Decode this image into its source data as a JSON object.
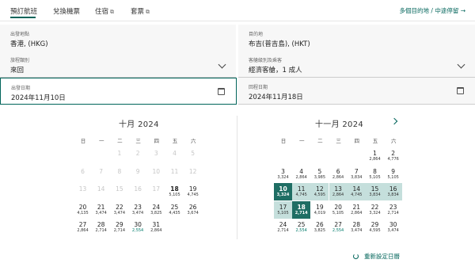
{
  "tabs": [
    {
      "label": "預訂航班",
      "external": false
    },
    {
      "label": "兌換機票",
      "external": false
    },
    {
      "label": "住宿",
      "external": true
    },
    {
      "label": "套票",
      "external": true
    }
  ],
  "multi_city_link": "多個目的地 / 中途停留 →",
  "form": {
    "origin": {
      "label": "出發地點",
      "value": "香港, (HKG)"
    },
    "destination": {
      "label": "目的地",
      "value": "布吉(普吉島), (HKT)"
    },
    "trip_type": {
      "label": "旅程類別",
      "value": "來回"
    },
    "cabin": {
      "label": "客艙級別及乘客",
      "value": "經濟客艙，1 成人"
    },
    "depart": {
      "label": "出發日期",
      "value": "2024年11月10日"
    },
    "return": {
      "label": "回程日期",
      "value": "2024年11月18日"
    }
  },
  "weekdays": [
    "日",
    "一",
    "二",
    "三",
    "四",
    "五",
    "六"
  ],
  "calendars": [
    {
      "title": "十月 2024",
      "days": [
        {
          "d": "",
          "p": ""
        },
        {
          "d": "",
          "p": ""
        },
        {
          "d": "1",
          "p": "",
          "s": "disabled"
        },
        {
          "d": "2",
          "p": "",
          "s": "disabled"
        },
        {
          "d": "3",
          "p": "",
          "s": "disabled"
        },
        {
          "d": "4",
          "p": "",
          "s": "disabled"
        },
        {
          "d": "5",
          "p": "",
          "s": "disabled"
        },
        {
          "d": "6",
          "p": "",
          "s": "disabled"
        },
        {
          "d": "7",
          "p": "",
          "s": "disabled"
        },
        {
          "d": "8",
          "p": "",
          "s": "disabled"
        },
        {
          "d": "9",
          "p": "",
          "s": "disabled"
        },
        {
          "d": "10",
          "p": "",
          "s": "disabled"
        },
        {
          "d": "11",
          "p": "",
          "s": "disabled"
        },
        {
          "d": "12",
          "p": "",
          "s": "disabled"
        },
        {
          "d": "13",
          "p": "",
          "s": "disabled"
        },
        {
          "d": "14",
          "p": "",
          "s": "disabled"
        },
        {
          "d": "15",
          "p": "",
          "s": "disabled"
        },
        {
          "d": "16",
          "p": "",
          "s": "disabled"
        },
        {
          "d": "17",
          "p": "",
          "s": "disabled"
        },
        {
          "d": "18",
          "p": "5,105",
          "s": "bold"
        },
        {
          "d": "19",
          "p": "4,745"
        },
        {
          "d": "20",
          "p": "4,135"
        },
        {
          "d": "21",
          "p": "3,474"
        },
        {
          "d": "22",
          "p": "3,474"
        },
        {
          "d": "23",
          "p": "3,474"
        },
        {
          "d": "24",
          "p": "3,825"
        },
        {
          "d": "25",
          "p": "4,435"
        },
        {
          "d": "26",
          "p": "3,674"
        },
        {
          "d": "27",
          "p": "2,864"
        },
        {
          "d": "28",
          "p": "2,714"
        },
        {
          "d": "29",
          "p": "2,714"
        },
        {
          "d": "30",
          "p": "2,554",
          "s": "green"
        },
        {
          "d": "31",
          "p": "2,864"
        },
        {
          "d": "",
          "p": ""
        },
        {
          "d": "",
          "p": ""
        }
      ]
    },
    {
      "title": "十一月 2024",
      "days": [
        {
          "d": "",
          "p": ""
        },
        {
          "d": "",
          "p": ""
        },
        {
          "d": "",
          "p": ""
        },
        {
          "d": "",
          "p": ""
        },
        {
          "d": "",
          "p": ""
        },
        {
          "d": "1",
          "p": "2,864"
        },
        {
          "d": "2",
          "p": "4,776"
        },
        {
          "d": "3",
          "p": "3,324"
        },
        {
          "d": "4",
          "p": "2,864"
        },
        {
          "d": "5",
          "p": "3,985"
        },
        {
          "d": "6",
          "p": "2,864"
        },
        {
          "d": "7",
          "p": "3,834"
        },
        {
          "d": "8",
          "p": "5,105"
        },
        {
          "d": "9",
          "p": "5,105"
        },
        {
          "d": "10",
          "p": "3,324",
          "s": "selected"
        },
        {
          "d": "11",
          "p": "4,745",
          "s": "range"
        },
        {
          "d": "12",
          "p": "4,595",
          "s": "range"
        },
        {
          "d": "13",
          "p": "2,864",
          "s": "range"
        },
        {
          "d": "14",
          "p": "4,745",
          "s": "range"
        },
        {
          "d": "15",
          "p": "3,834",
          "s": "range"
        },
        {
          "d": "16",
          "p": "3,834",
          "s": "range"
        },
        {
          "d": "17",
          "p": "5,105",
          "s": "range"
        },
        {
          "d": "18",
          "p": "2,714",
          "s": "selected"
        },
        {
          "d": "19",
          "p": "4,019"
        },
        {
          "d": "20",
          "p": "5,105"
        },
        {
          "d": "21",
          "p": "2,864"
        },
        {
          "d": "22",
          "p": "3,324"
        },
        {
          "d": "23",
          "p": "2,714"
        },
        {
          "d": "24",
          "p": "2,714"
        },
        {
          "d": "25",
          "p": "2,554",
          "s": "green"
        },
        {
          "d": "26",
          "p": "3,825"
        },
        {
          "d": "27",
          "p": "2,554",
          "s": "green"
        },
        {
          "d": "28",
          "p": "3,474"
        },
        {
          "d": "29",
          "p": "4,595"
        },
        {
          "d": "30",
          "p": "3,474"
        }
      ]
    }
  ],
  "reset_label": "重新設定日曆"
}
